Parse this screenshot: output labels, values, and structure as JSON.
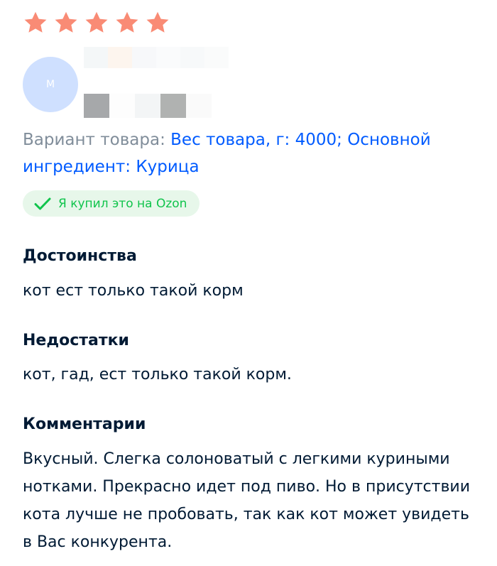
{
  "review": {
    "rating": 5,
    "rating_max": 5,
    "star_color": "#f98b75",
    "author_initial": "М",
    "avatar_color": "#cfe0ff",
    "variant_label": "Вариант товара: ",
    "variant_value": "Вес товара, г: 4000; Основной ингредиент: Курица",
    "verified_badge": "Я купил это на Ozon",
    "pros_title": "Достоинства",
    "pros_text": "кот ест только такой корм",
    "cons_title": "Недостатки",
    "cons_text": "кот, гад, ест только такой корм.",
    "comment_title": "Комментарии",
    "comment_text": "Вкусный. Слегка солоноватый с легкими куриными нотками. Прекрасно идет под пиво. Но в присутствии кота лучше не пробовать, так как кот может увидеть в Вас конкурента."
  }
}
